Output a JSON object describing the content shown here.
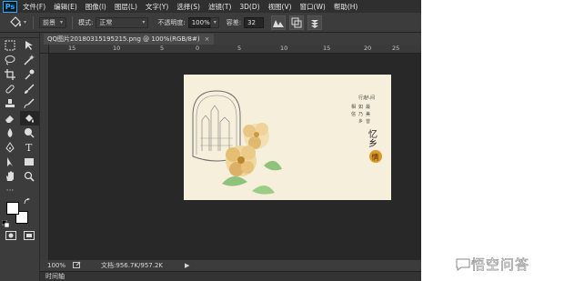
{
  "app": {
    "logo": "Ps"
  },
  "menu": [
    "文件(F)",
    "编辑(E)",
    "图像(I)",
    "图层(L)",
    "文字(Y)",
    "选择(S)",
    "滤镜(T)",
    "3D(D)",
    "视图(V)",
    "窗口(W)",
    "帮助(H)"
  ],
  "options": {
    "sample_value": "前景",
    "mode_label": "模式:",
    "mode_value": "正常",
    "opacity_label": "不透明度:",
    "opacity_value": "100%",
    "tolerance_label": "容差:",
    "tolerance_value": "32"
  },
  "document": {
    "tab_title": "QQ图片20180315195215.png @ 100%(RGB/8#)",
    "tab_close": "×",
    "ruler_labels": [
      "15",
      "10",
      "5",
      "0",
      "5",
      "10",
      "15",
      "20",
      "25"
    ],
    "zoom": "100%",
    "doc_info": "文档:956.7K/957.2K",
    "timeline_label": "时间轴"
  },
  "artwork": {
    "vertical_text_cols": [
      "人间",
      "行走",
      "最",
      "如",
      "美",
      "乃",
      "曾",
      "乡",
      "相",
      "信"
    ],
    "title": "忆乡",
    "seal": "情"
  },
  "watermark": {
    "text": "悟空问答"
  },
  "icons": {
    "tools": [
      "move-tool-icon",
      "marquee-tool-icon",
      "lasso-tool-icon",
      "magic-wand-icon",
      "crop-tool-icon",
      "eyedropper-icon",
      "healing-brush-icon",
      "brush-tool-icon",
      "clone-stamp-icon",
      "history-brush-icon",
      "eraser-icon",
      "paint-bucket-icon",
      "blur-tool-icon",
      "dodge-tool-icon",
      "pen-tool-icon",
      "type-tool-icon",
      "path-select-icon",
      "rectangle-tool-icon",
      "hand-tool-icon",
      "zoom-tool-icon"
    ]
  },
  "colors": {
    "menubar": "#2f2f2f",
    "panel": "#3c3c3c",
    "canvas": "#282828",
    "accent": "#31a8ff",
    "image_bg": "#f5efdc"
  }
}
